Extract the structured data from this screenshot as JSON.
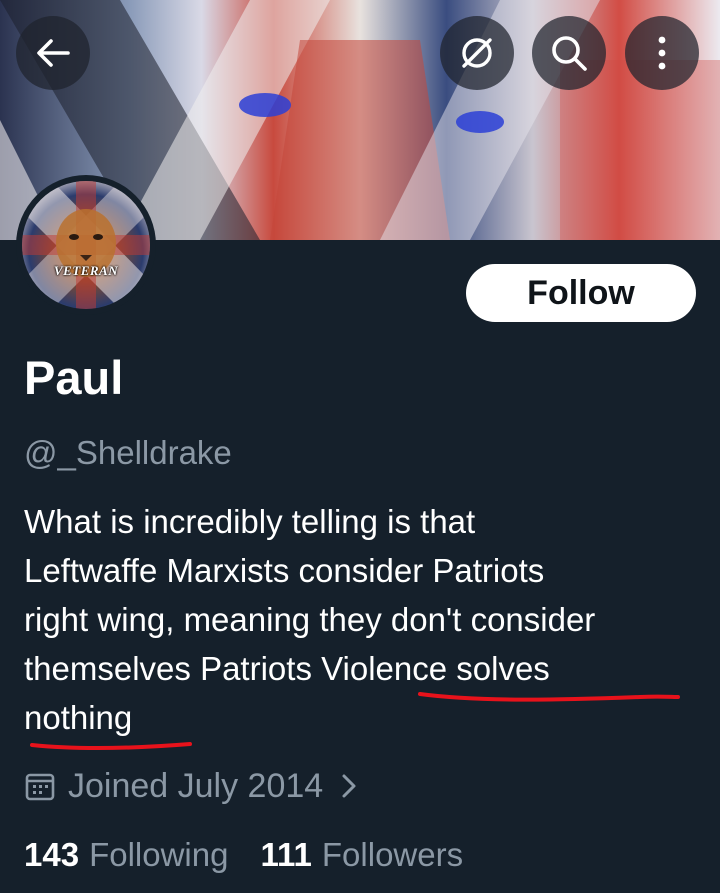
{
  "header": {
    "back_icon": "arrow-left-icon",
    "mute_icon": "eye-slash-icon",
    "search_icon": "search-icon",
    "more_icon": "more-vertical-icon"
  },
  "profile": {
    "avatar_text": "VETERAN",
    "follow_label": "Follow",
    "name": "Paul",
    "handle": "@_Shelldrake",
    "bio": "What is incredibly telling is that\nLeftwaffe Marxists consider Patriots\nright wing, meaning they don't consider\nthemselves Patriots     Violence solves\nnothing",
    "joined": "Joined July 2014",
    "following_count": "143",
    "following_label": "Following",
    "followers_count": "111",
    "followers_label": "Followers"
  },
  "colors": {
    "background": "#15202b",
    "secondary_text": "#8b98a5",
    "underline_annotation": "#e8121b"
  }
}
